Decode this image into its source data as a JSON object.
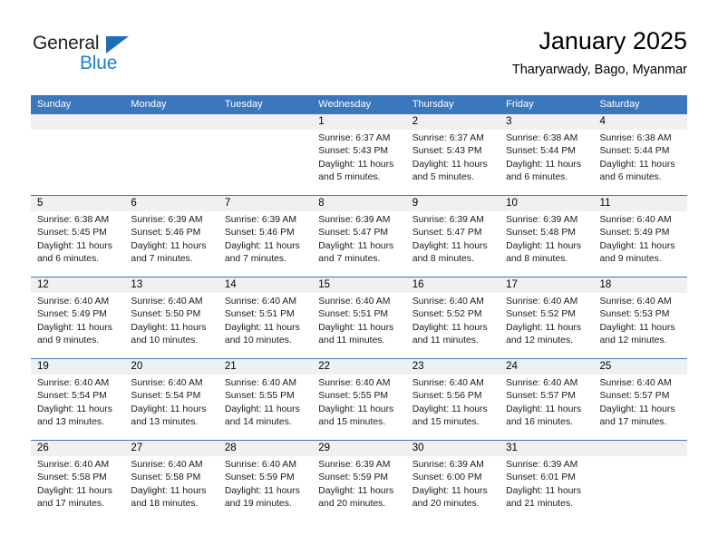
{
  "brand": {
    "name_top": "General",
    "name_bottom": "Blue",
    "triangle_color": "#1d6fb8",
    "blue_color": "#1d80d0"
  },
  "header": {
    "title": "January 2025",
    "subtitle": "Tharyarwady, Bago, Myanmar"
  },
  "theme": {
    "header_bg": "#3b77bd",
    "date_band_bg": "#f0f0f0",
    "text": "#000000"
  },
  "calendar": {
    "weekday_headers": [
      "Sunday",
      "Monday",
      "Tuesday",
      "Wednesday",
      "Thursday",
      "Friday",
      "Saturday"
    ],
    "weeks": [
      [
        {
          "day": "",
          "lines": []
        },
        {
          "day": "",
          "lines": []
        },
        {
          "day": "",
          "lines": []
        },
        {
          "day": "1",
          "lines": [
            "Sunrise: 6:37 AM",
            "Sunset: 5:43 PM",
            "Daylight: 11 hours",
            "and 5 minutes."
          ]
        },
        {
          "day": "2",
          "lines": [
            "Sunrise: 6:37 AM",
            "Sunset: 5:43 PM",
            "Daylight: 11 hours",
            "and 5 minutes."
          ]
        },
        {
          "day": "3",
          "lines": [
            "Sunrise: 6:38 AM",
            "Sunset: 5:44 PM",
            "Daylight: 11 hours",
            "and 6 minutes."
          ]
        },
        {
          "day": "4",
          "lines": [
            "Sunrise: 6:38 AM",
            "Sunset: 5:44 PM",
            "Daylight: 11 hours",
            "and 6 minutes."
          ]
        }
      ],
      [
        {
          "day": "5",
          "lines": [
            "Sunrise: 6:38 AM",
            "Sunset: 5:45 PM",
            "Daylight: 11 hours",
            "and 6 minutes."
          ]
        },
        {
          "day": "6",
          "lines": [
            "Sunrise: 6:39 AM",
            "Sunset: 5:46 PM",
            "Daylight: 11 hours",
            "and 7 minutes."
          ]
        },
        {
          "day": "7",
          "lines": [
            "Sunrise: 6:39 AM",
            "Sunset: 5:46 PM",
            "Daylight: 11 hours",
            "and 7 minutes."
          ]
        },
        {
          "day": "8",
          "lines": [
            "Sunrise: 6:39 AM",
            "Sunset: 5:47 PM",
            "Daylight: 11 hours",
            "and 7 minutes."
          ]
        },
        {
          "day": "9",
          "lines": [
            "Sunrise: 6:39 AM",
            "Sunset: 5:47 PM",
            "Daylight: 11 hours",
            "and 8 minutes."
          ]
        },
        {
          "day": "10",
          "lines": [
            "Sunrise: 6:39 AM",
            "Sunset: 5:48 PM",
            "Daylight: 11 hours",
            "and 8 minutes."
          ]
        },
        {
          "day": "11",
          "lines": [
            "Sunrise: 6:40 AM",
            "Sunset: 5:49 PM",
            "Daylight: 11 hours",
            "and 9 minutes."
          ]
        }
      ],
      [
        {
          "day": "12",
          "lines": [
            "Sunrise: 6:40 AM",
            "Sunset: 5:49 PM",
            "Daylight: 11 hours",
            "and 9 minutes."
          ]
        },
        {
          "day": "13",
          "lines": [
            "Sunrise: 6:40 AM",
            "Sunset: 5:50 PM",
            "Daylight: 11 hours",
            "and 10 minutes."
          ]
        },
        {
          "day": "14",
          "lines": [
            "Sunrise: 6:40 AM",
            "Sunset: 5:51 PM",
            "Daylight: 11 hours",
            "and 10 minutes."
          ]
        },
        {
          "day": "15",
          "lines": [
            "Sunrise: 6:40 AM",
            "Sunset: 5:51 PM",
            "Daylight: 11 hours",
            "and 11 minutes."
          ]
        },
        {
          "day": "16",
          "lines": [
            "Sunrise: 6:40 AM",
            "Sunset: 5:52 PM",
            "Daylight: 11 hours",
            "and 11 minutes."
          ]
        },
        {
          "day": "17",
          "lines": [
            "Sunrise: 6:40 AM",
            "Sunset: 5:52 PM",
            "Daylight: 11 hours",
            "and 12 minutes."
          ]
        },
        {
          "day": "18",
          "lines": [
            "Sunrise: 6:40 AM",
            "Sunset: 5:53 PM",
            "Daylight: 11 hours",
            "and 12 minutes."
          ]
        }
      ],
      [
        {
          "day": "19",
          "lines": [
            "Sunrise: 6:40 AM",
            "Sunset: 5:54 PM",
            "Daylight: 11 hours",
            "and 13 minutes."
          ]
        },
        {
          "day": "20",
          "lines": [
            "Sunrise: 6:40 AM",
            "Sunset: 5:54 PM",
            "Daylight: 11 hours",
            "and 13 minutes."
          ]
        },
        {
          "day": "21",
          "lines": [
            "Sunrise: 6:40 AM",
            "Sunset: 5:55 PM",
            "Daylight: 11 hours",
            "and 14 minutes."
          ]
        },
        {
          "day": "22",
          "lines": [
            "Sunrise: 6:40 AM",
            "Sunset: 5:55 PM",
            "Daylight: 11 hours",
            "and 15 minutes."
          ]
        },
        {
          "day": "23",
          "lines": [
            "Sunrise: 6:40 AM",
            "Sunset: 5:56 PM",
            "Daylight: 11 hours",
            "and 15 minutes."
          ]
        },
        {
          "day": "24",
          "lines": [
            "Sunrise: 6:40 AM",
            "Sunset: 5:57 PM",
            "Daylight: 11 hours",
            "and 16 minutes."
          ]
        },
        {
          "day": "25",
          "lines": [
            "Sunrise: 6:40 AM",
            "Sunset: 5:57 PM",
            "Daylight: 11 hours",
            "and 17 minutes."
          ]
        }
      ],
      [
        {
          "day": "26",
          "lines": [
            "Sunrise: 6:40 AM",
            "Sunset: 5:58 PM",
            "Daylight: 11 hours",
            "and 17 minutes."
          ]
        },
        {
          "day": "27",
          "lines": [
            "Sunrise: 6:40 AM",
            "Sunset: 5:58 PM",
            "Daylight: 11 hours",
            "and 18 minutes."
          ]
        },
        {
          "day": "28",
          "lines": [
            "Sunrise: 6:40 AM",
            "Sunset: 5:59 PM",
            "Daylight: 11 hours",
            "and 19 minutes."
          ]
        },
        {
          "day": "29",
          "lines": [
            "Sunrise: 6:39 AM",
            "Sunset: 5:59 PM",
            "Daylight: 11 hours",
            "and 20 minutes."
          ]
        },
        {
          "day": "30",
          "lines": [
            "Sunrise: 6:39 AM",
            "Sunset: 6:00 PM",
            "Daylight: 11 hours",
            "and 20 minutes."
          ]
        },
        {
          "day": "31",
          "lines": [
            "Sunrise: 6:39 AM",
            "Sunset: 6:01 PM",
            "Daylight: 11 hours",
            "and 21 minutes."
          ]
        },
        {
          "day": "",
          "lines": []
        }
      ]
    ]
  }
}
